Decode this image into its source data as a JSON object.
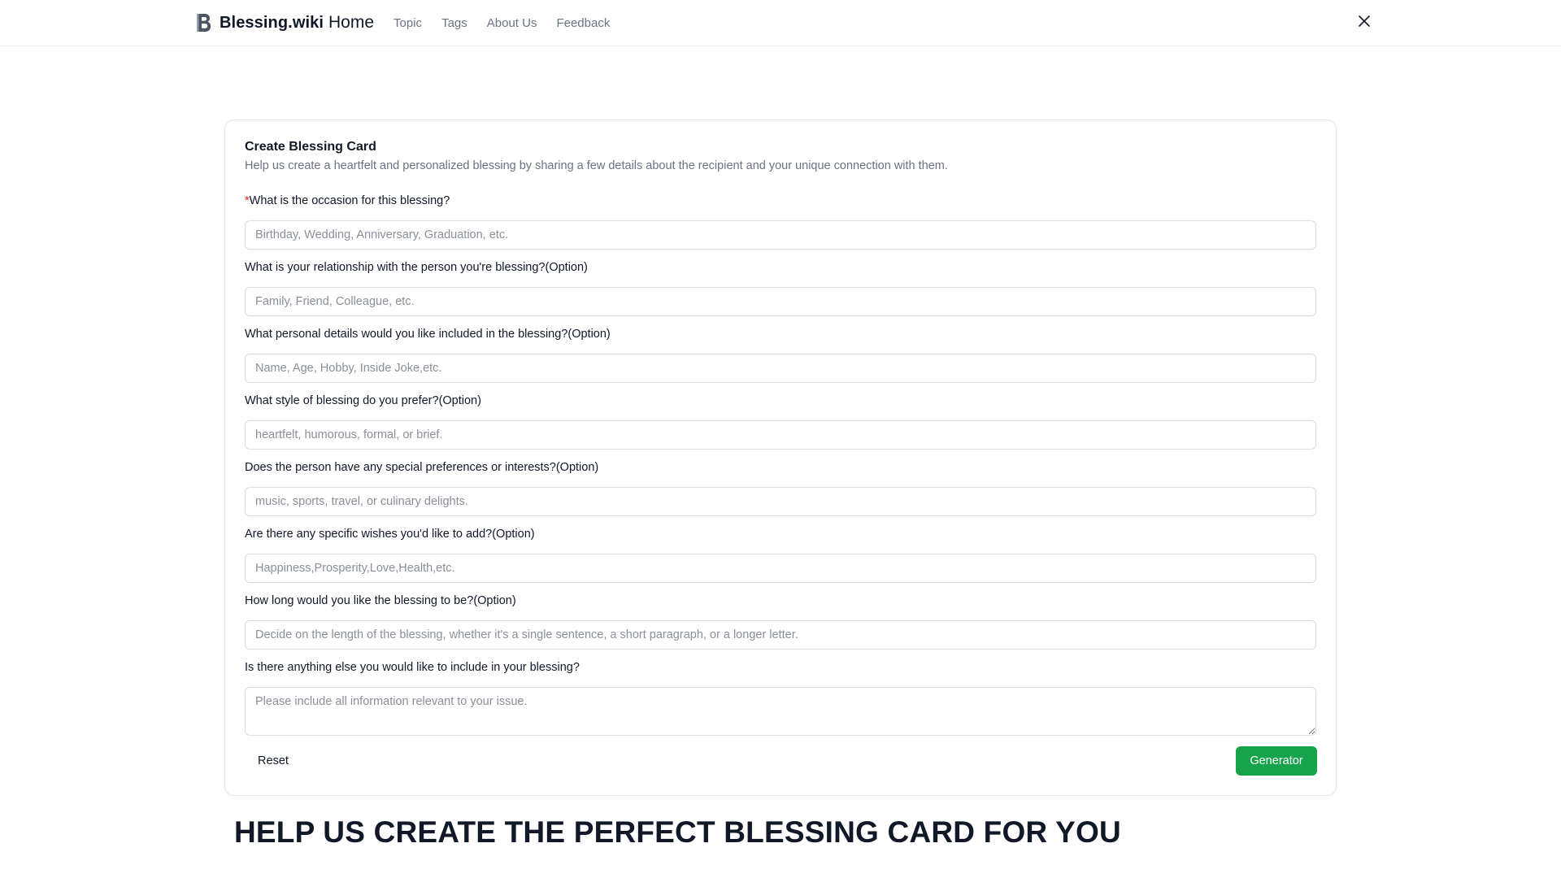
{
  "header": {
    "brand_name": "Blessing.wiki",
    "nav": {
      "home": "Home",
      "topic": "Topic",
      "tags": "Tags",
      "about": "About Us",
      "feedback": "Feedback"
    },
    "social_icon": "x-logo-icon"
  },
  "card": {
    "title": "Create Blessing Card",
    "description": "Help us create a heartfelt and personalized blessing by sharing a few details about the recipient and your unique connection with them.",
    "required_marker": "*",
    "fields": [
      {
        "label": "What is the occasion for this blessing?",
        "placeholder": "Birthday, Wedding, Anniversary, Graduation, etc.",
        "value": "",
        "required": true
      },
      {
        "label": "What is your relationship with the person you're blessing?(Option)",
        "placeholder": "Family, Friend, Colleague, etc.",
        "value": ""
      },
      {
        "label": "What personal details would you like included in the blessing?(Option)",
        "placeholder": "Name, Age, Hobby, Inside Joke,etc.",
        "value": ""
      },
      {
        "label": "What style of blessing do you prefer?(Option)",
        "placeholder": "heartfelt, humorous, formal, or brief.",
        "value": ""
      },
      {
        "label": "Does the person have any special preferences or interests?(Option)",
        "placeholder": "music, sports, travel, or culinary delights.",
        "value": ""
      },
      {
        "label": "Are there any specific wishes you'd like to add?(Option)",
        "placeholder": "Happiness,Prosperity,Love,Health,etc.",
        "value": ""
      },
      {
        "label": "How long would you like the blessing to be?(Option)",
        "placeholder": "Decide on the length of the blessing, whether it's a single sentence, a short paragraph, or a longer letter.",
        "value": ""
      },
      {
        "label": "Is there anything else you would like to include in your blessing?",
        "placeholder": "Please include all information relevant to your issue.",
        "value": ""
      }
    ],
    "reset_label": "Reset",
    "generate_label": "Generator"
  },
  "hero": {
    "heading": "HELP US CREATE THE PERFECT BLESSING CARD FOR YOU"
  },
  "colors": {
    "primary_button": "#16a34a",
    "required": "#dc2626",
    "muted_text": "#6b7280"
  }
}
